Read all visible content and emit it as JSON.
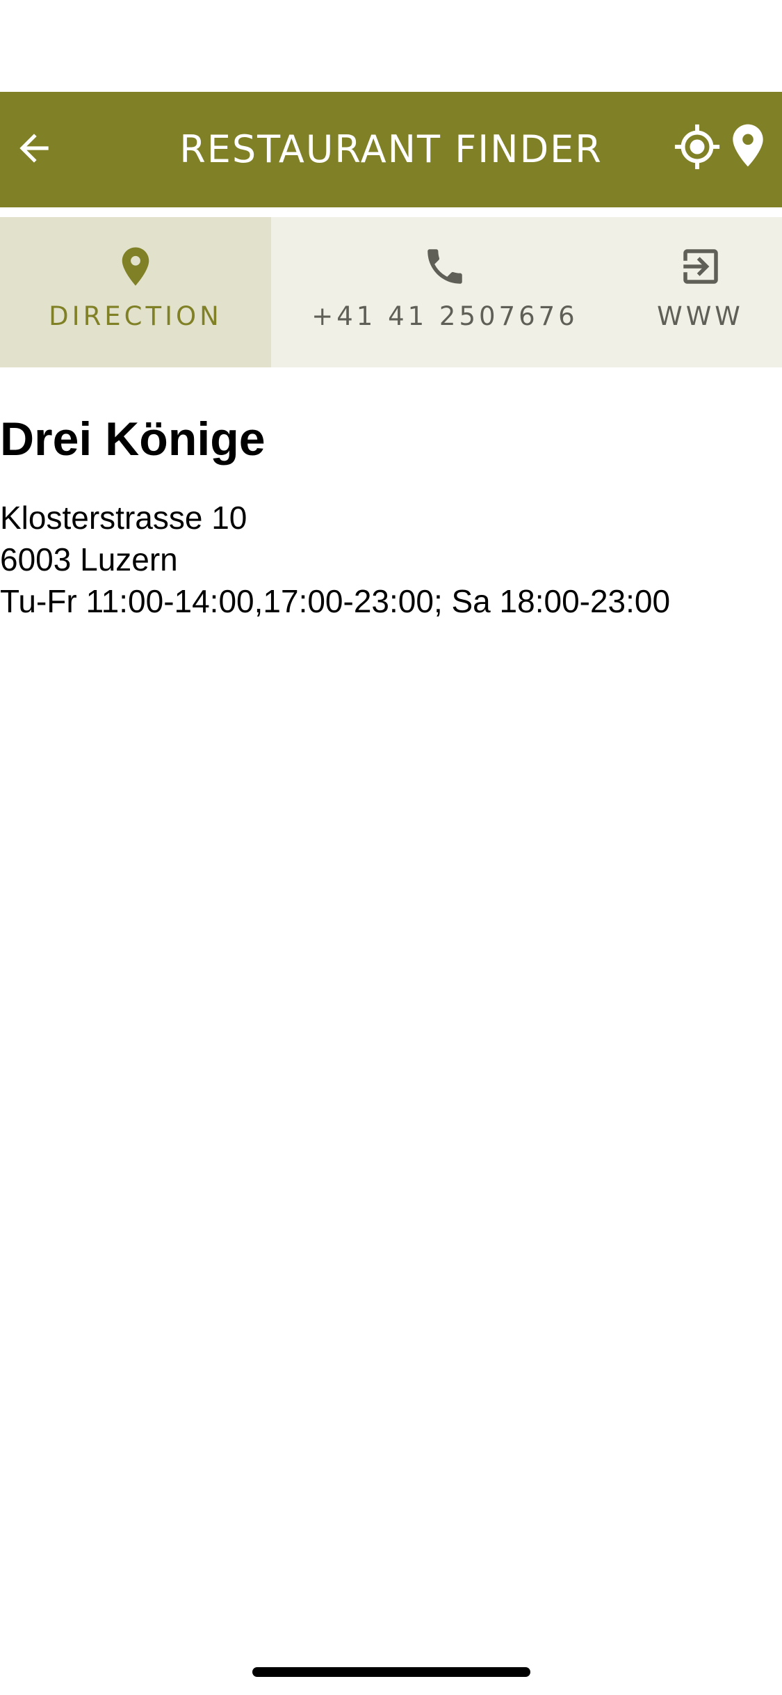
{
  "app_bar": {
    "title": "RESTAURANT FINDER",
    "back_icon": "arrow-left-icon",
    "locate_icon": "crosshair-locate-icon",
    "map_icon": "map-pin-icon",
    "background_color": "#808026",
    "text_color": "#ffffff"
  },
  "actions": {
    "direction": {
      "label": "DIRECTION",
      "icon": "map-pin-icon",
      "active": true
    },
    "phone": {
      "label": "+41 41 2507676",
      "icon": "phone-icon",
      "active": false
    },
    "www": {
      "label": "WWW",
      "icon": "open-link-icon",
      "active": false
    },
    "active_color": "#808026",
    "inactive_color": "#5f5f57"
  },
  "restaurant": {
    "name": "Drei Könige",
    "street": "Klosterstrasse 10",
    "city": "6003 Luzern",
    "hours": "Tu-Fr 11:00-14:00,17:00-23:00; Sa 18:00-23:00"
  }
}
